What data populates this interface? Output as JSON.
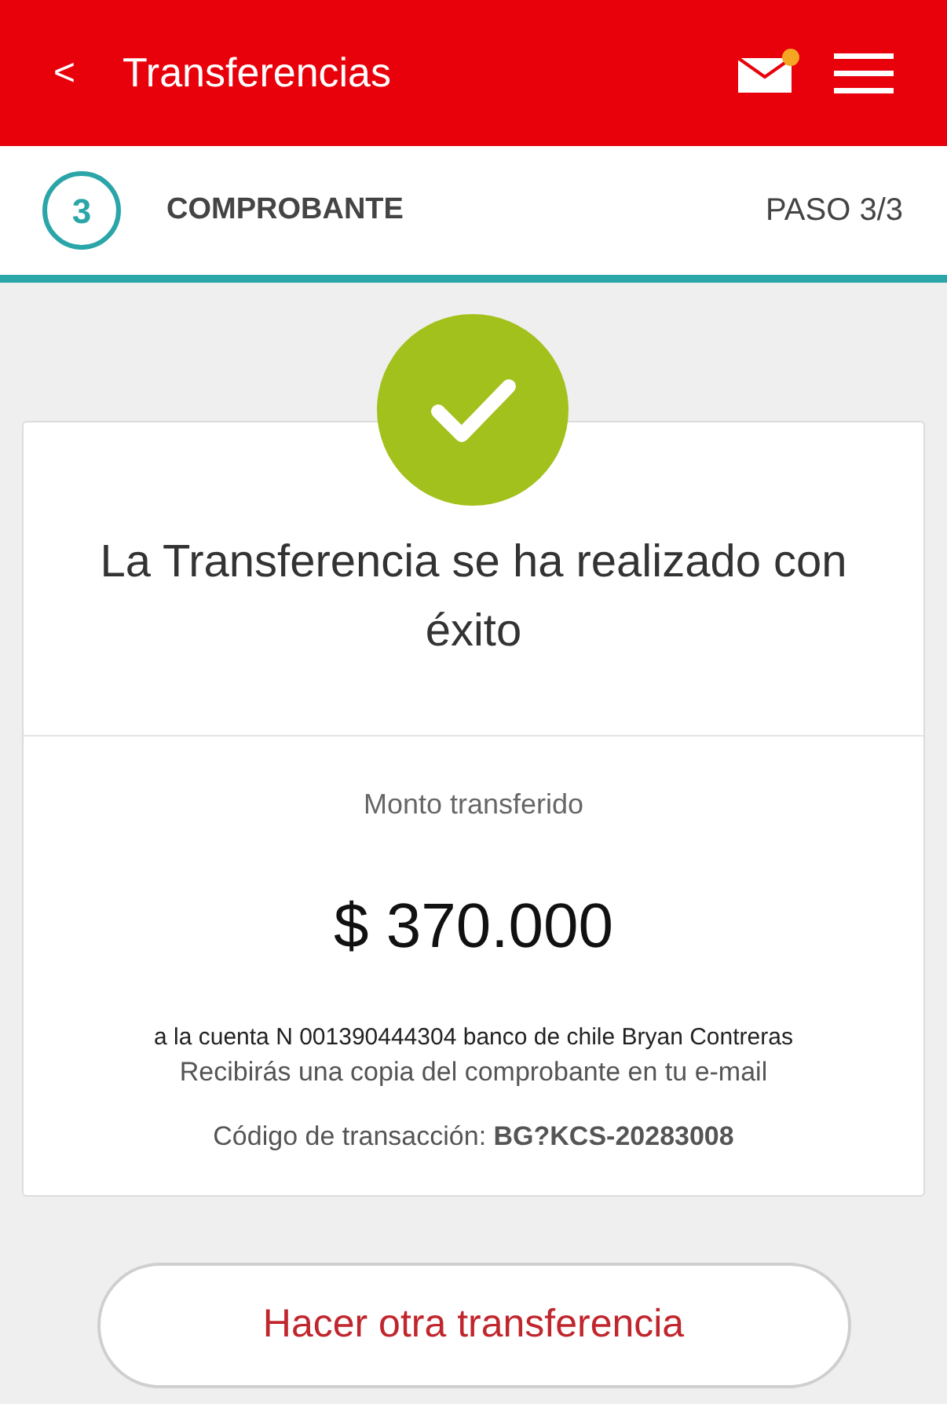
{
  "header": {
    "back": "<",
    "title": "Transferencias",
    "mail_unread": true
  },
  "step": {
    "number": "3",
    "label": "COMPROBANTE",
    "progress": "PASO 3/3"
  },
  "result": {
    "title": "La Transferencia se ha realizado con éxito",
    "amount_label": "Monto transferido",
    "amount": "$ 370.000",
    "account": "a la cuenta N 001390444304 banco de chile Bryan Contreras",
    "email_note": "Recibirás una copia del comprobante en tu e-mail",
    "code": "Código de transacción: **BG?KCS-20283008**"
  },
  "button": {
    "label": "Hacer otra transferencia"
  }
}
